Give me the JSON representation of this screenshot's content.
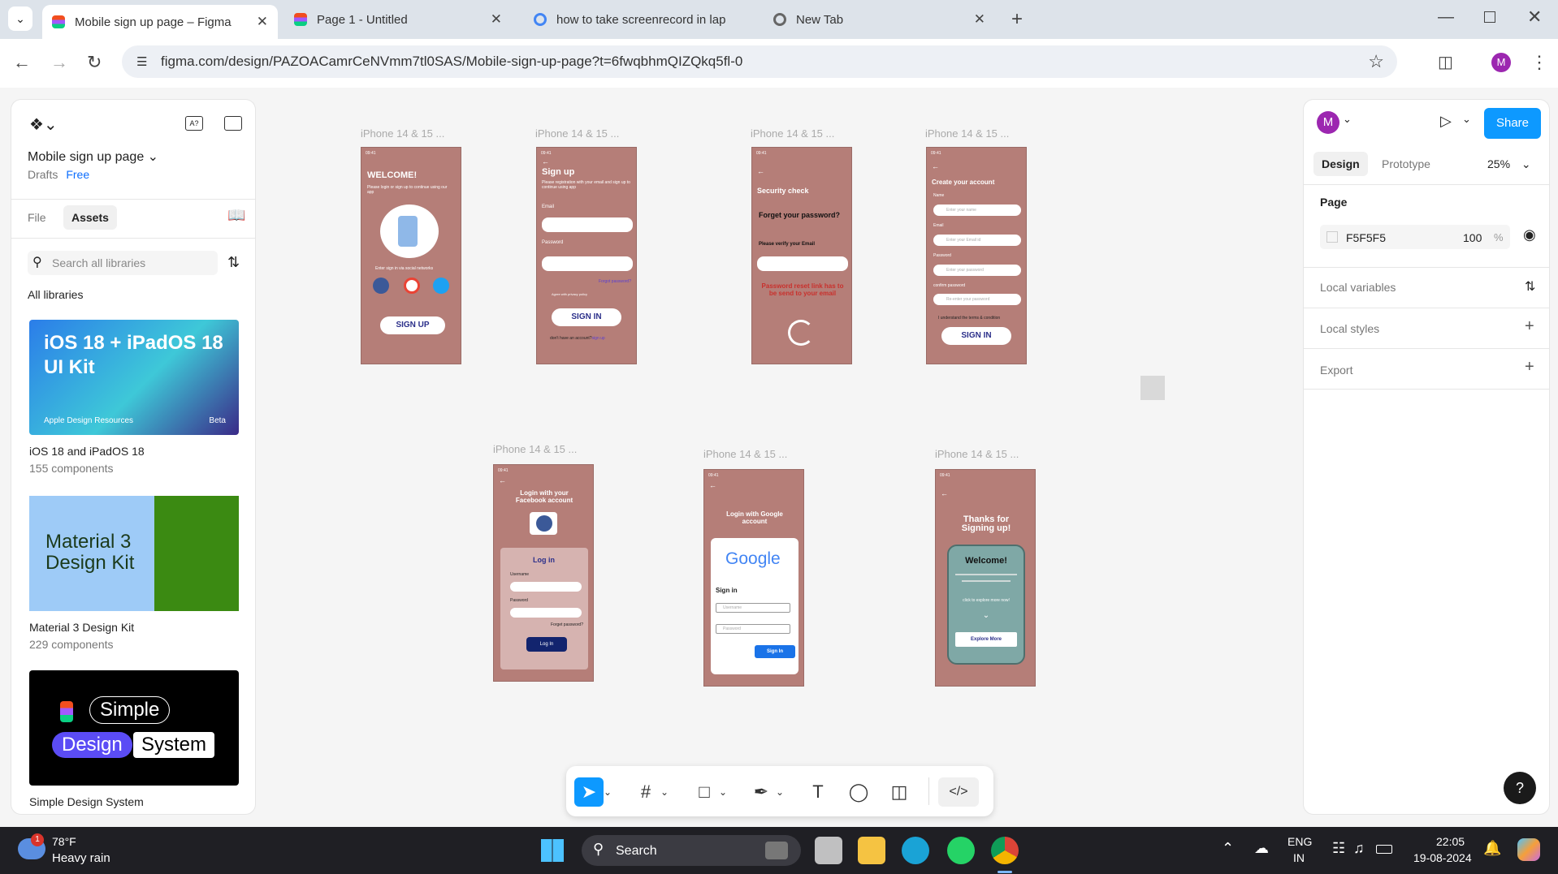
{
  "tabs": [
    {
      "title": "Mobile sign up page – Figma",
      "active": true,
      "color": "#a259ff"
    },
    {
      "title": "Page 1 - Untitled",
      "active": false,
      "color": "#f24e1e"
    },
    {
      "title": "how to take screenrecord in lap",
      "active": false,
      "color": "#4285f4"
    },
    {
      "title": "New Tab",
      "active": false,
      "color": "#777777"
    }
  ],
  "address": {
    "url": "figma.com/design/PAZOACamrCeNVmm7tl0SAS/Mobile-sign-up-page?t=6fwqbhmQIZQkq5fl-0",
    "profile": "M"
  },
  "left": {
    "file_name": "Mobile sign up page",
    "drafts": "Drafts",
    "plan": "Free",
    "tab_file": "File",
    "tab_assets": "Assets",
    "search_placeholder": "Search all libraries",
    "all_libraries": "All libraries",
    "libs": [
      {
        "thumb": "iOS 18 + iPadOS 18 UI Kit",
        "thumb_sub": "Apple Design Resources",
        "thumb_tag": "Beta",
        "name": "iOS 18 and iPadOS 18",
        "count": "155 components"
      },
      {
        "thumb": "Material 3 Design Kit",
        "name": "Material 3 Design Kit",
        "count": "229 components"
      },
      {
        "thumb_a": "Simple",
        "thumb_b": "Design",
        "thumb_c": "System",
        "name": "Simple Design System"
      }
    ]
  },
  "right": {
    "avatar": "M",
    "share": "Share",
    "tab_design": "Design",
    "tab_prototype": "Prototype",
    "zoom": "25%",
    "page": "Page",
    "page_color": "F5F5F5",
    "opacity": "100",
    "pct": "%",
    "local_variables": "Local variables",
    "local_styles": "Local styles",
    "export": "Export",
    "help": "?"
  },
  "frames": {
    "title": "iPhone 14 & 15 ...",
    "time": "09:41",
    "f1": {
      "welcome": "WELCOME!",
      "sub": "Please login or sign up to continue using our app",
      "social": "Enter sign in via social networks",
      "btn": "SIGN UP"
    },
    "f2": {
      "title": "Sign up",
      "sub": "Please registration with your email and sign up to continue using app",
      "email": "Email",
      "password": "Password",
      "forgot": "Forgot password?",
      "agree": "Agree with privacy policy",
      "btn": "SIGN IN",
      "dont": "don't have an account?",
      "signup": "sign up"
    },
    "f3": {
      "title": "Security check",
      "forget": "Forget your password?",
      "verify": "Please verify your Email",
      "reset": "Password reset link has to be send to your email"
    },
    "f4": {
      "title": "Create your account",
      "name": "Name",
      "name_ph": "Enter your name",
      "email": "Email",
      "email_ph": "Enter your Email id",
      "password": "Password",
      "password_ph": "Enter your password",
      "confirm": "confirm password",
      "confirm_ph": "Re-enter your password",
      "terms": "I understand the terms & condition",
      "btn": "SIGN IN"
    },
    "f5": {
      "title": "Login with your Facebook account",
      "login": "Log in",
      "username": "Username",
      "password": "Password",
      "forgot": "Forget password?",
      "btn": "Log In"
    },
    "f6": {
      "title": "Login with Google account",
      "google": "Google",
      "signin": "Sign in",
      "username": "Username",
      "password": "Password",
      "btn": "Sign In"
    },
    "f7": {
      "title": "Thanks for Signing up!",
      "welcome": "Welcome!",
      "click": "click to explore more now!",
      "btn": "Explore More"
    }
  },
  "taskbar": {
    "temp": "78°F",
    "weather": "Heavy rain",
    "badge": "1",
    "search": "Search",
    "lang1": "ENG",
    "lang2": "IN",
    "time": "22:05",
    "date": "19-08-2024"
  }
}
